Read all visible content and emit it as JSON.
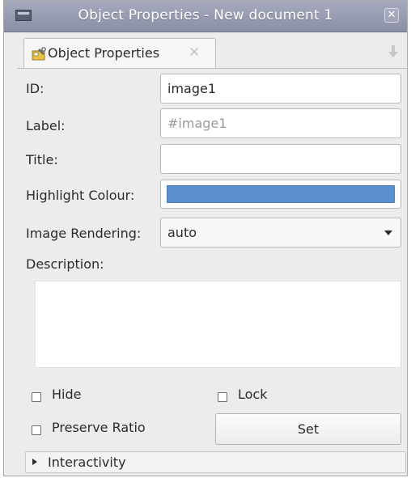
{
  "window": {
    "title": "Object Properties - New document 1",
    "close_glyph": "✕",
    "icons": {
      "menu": "window-menu-icon",
      "close": "close-icon"
    }
  },
  "tab": {
    "label": "Object Properties",
    "close_glyph": "✕",
    "icon": "object-properties-icon",
    "dock_icon": "dock-icon"
  },
  "form": {
    "id_label": "ID:",
    "id_value": "image1",
    "label_label": "Label:",
    "label_placeholder": "#image1",
    "title_label": "Title:",
    "title_value": "",
    "highlight_label": "Highlight Colour:",
    "highlight_color": "#5b8fcf",
    "rendering_label": "Image Rendering:",
    "rendering_value": "auto",
    "description_label": "Description:",
    "description_value": ""
  },
  "options": {
    "hide_label": "Hide",
    "hide_checked": false,
    "lock_label": "Lock",
    "lock_checked": false,
    "preserve_label": "Preserve Ratio",
    "preserve_checked": false,
    "set_label": "Set"
  },
  "interactivity": {
    "label": "Interactivity",
    "expanded": false
  }
}
